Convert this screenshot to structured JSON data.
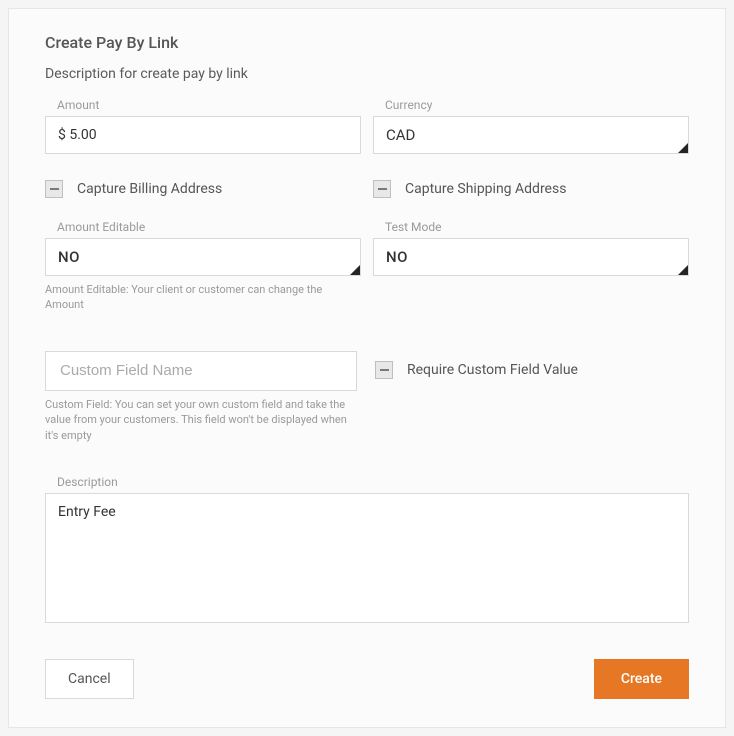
{
  "title": "Create Pay By Link",
  "subtitle": "Description for create pay by link",
  "amount": {
    "label": "Amount",
    "value": "$ 5.00"
  },
  "currency": {
    "label": "Currency",
    "value": "CAD"
  },
  "captureBilling": {
    "label": "Capture Billing Address"
  },
  "captureShipping": {
    "label": "Capture Shipping Address"
  },
  "amountEditable": {
    "label": "Amount Editable",
    "value": "NO",
    "helper": "Amount Editable: Your client or customer can change the Amount"
  },
  "testMode": {
    "label": "Test Mode",
    "value": "NO"
  },
  "customField": {
    "placeholder": "Custom Field Name",
    "helper": "Custom Field: You can set your own custom field and take the value from your customers. This field won't be displayed when it's empty"
  },
  "requireCustom": {
    "label": "Require Custom Field Value"
  },
  "description": {
    "label": "Description",
    "value": "Entry Fee"
  },
  "buttons": {
    "cancel": "Cancel",
    "create": "Create"
  }
}
